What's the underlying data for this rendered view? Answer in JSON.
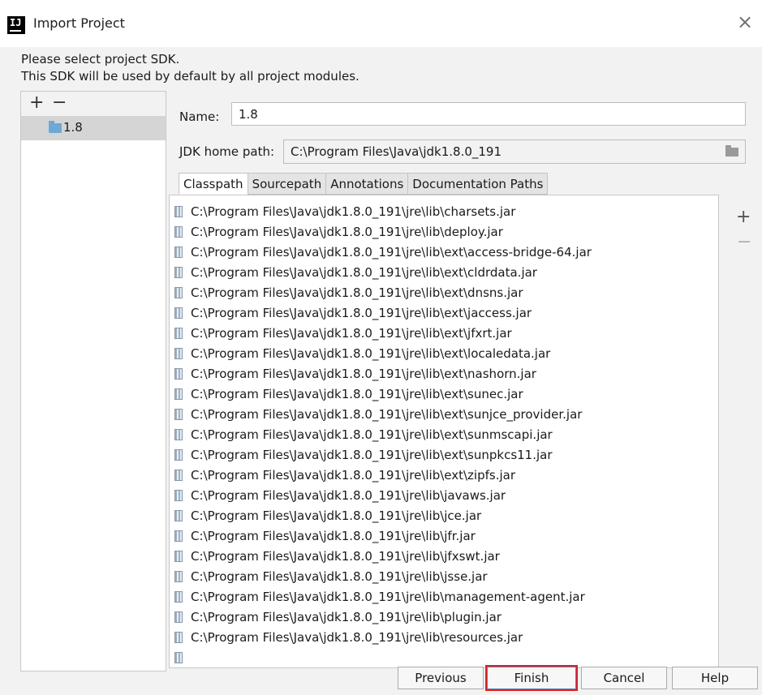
{
  "window": {
    "title": "Import Project",
    "app_icon": "IJ"
  },
  "intro": {
    "line1": "Please select project SDK.",
    "line2": "This SDK will be used by default by all project modules."
  },
  "sdk_list": {
    "add": "+",
    "remove": "−",
    "items": [
      {
        "label": "1.8",
        "icon": "folder-icon"
      }
    ]
  },
  "form": {
    "name_label": "Name:",
    "name_value": "1.8",
    "jdk_label": "JDK home path:",
    "jdk_value": "C:\\Program Files\\Java\\jdk1.8.0_191"
  },
  "tabs": [
    "Classpath",
    "Sourcepath",
    "Annotations",
    "Documentation Paths"
  ],
  "active_tab": "Classpath",
  "classpath": [
    "C:\\Program Files\\Java\\jdk1.8.0_191\\jre\\lib\\charsets.jar",
    "C:\\Program Files\\Java\\jdk1.8.0_191\\jre\\lib\\deploy.jar",
    "C:\\Program Files\\Java\\jdk1.8.0_191\\jre\\lib\\ext\\access-bridge-64.jar",
    "C:\\Program Files\\Java\\jdk1.8.0_191\\jre\\lib\\ext\\cldrdata.jar",
    "C:\\Program Files\\Java\\jdk1.8.0_191\\jre\\lib\\ext\\dnsns.jar",
    "C:\\Program Files\\Java\\jdk1.8.0_191\\jre\\lib\\ext\\jaccess.jar",
    "C:\\Program Files\\Java\\jdk1.8.0_191\\jre\\lib\\ext\\jfxrt.jar",
    "C:\\Program Files\\Java\\jdk1.8.0_191\\jre\\lib\\ext\\localedata.jar",
    "C:\\Program Files\\Java\\jdk1.8.0_191\\jre\\lib\\ext\\nashorn.jar",
    "C:\\Program Files\\Java\\jdk1.8.0_191\\jre\\lib\\ext\\sunec.jar",
    "C:\\Program Files\\Java\\jdk1.8.0_191\\jre\\lib\\ext\\sunjce_provider.jar",
    "C:\\Program Files\\Java\\jdk1.8.0_191\\jre\\lib\\ext\\sunmscapi.jar",
    "C:\\Program Files\\Java\\jdk1.8.0_191\\jre\\lib\\ext\\sunpkcs11.jar",
    "C:\\Program Files\\Java\\jdk1.8.0_191\\jre\\lib\\ext\\zipfs.jar",
    "C:\\Program Files\\Java\\jdk1.8.0_191\\jre\\lib\\javaws.jar",
    "C:\\Program Files\\Java\\jdk1.8.0_191\\jre\\lib\\jce.jar",
    "C:\\Program Files\\Java\\jdk1.8.0_191\\jre\\lib\\jfr.jar",
    "C:\\Program Files\\Java\\jdk1.8.0_191\\jre\\lib\\jfxswt.jar",
    "C:\\Program Files\\Java\\jdk1.8.0_191\\jre\\lib\\jsse.jar",
    "C:\\Program Files\\Java\\jdk1.8.0_191\\jre\\lib\\management-agent.jar",
    "C:\\Program Files\\Java\\jdk1.8.0_191\\jre\\lib\\plugin.jar",
    "C:\\Program Files\\Java\\jdk1.8.0_191\\jre\\lib\\resources.jar"
  ],
  "classpath_side": {
    "add": "+",
    "remove": "−"
  },
  "buttons": {
    "previous": "Previous",
    "finish": "Finish",
    "cancel": "Cancel",
    "help": "Help"
  },
  "colors": {
    "highlight": "#e02020",
    "selection": "#d5d5d5"
  }
}
